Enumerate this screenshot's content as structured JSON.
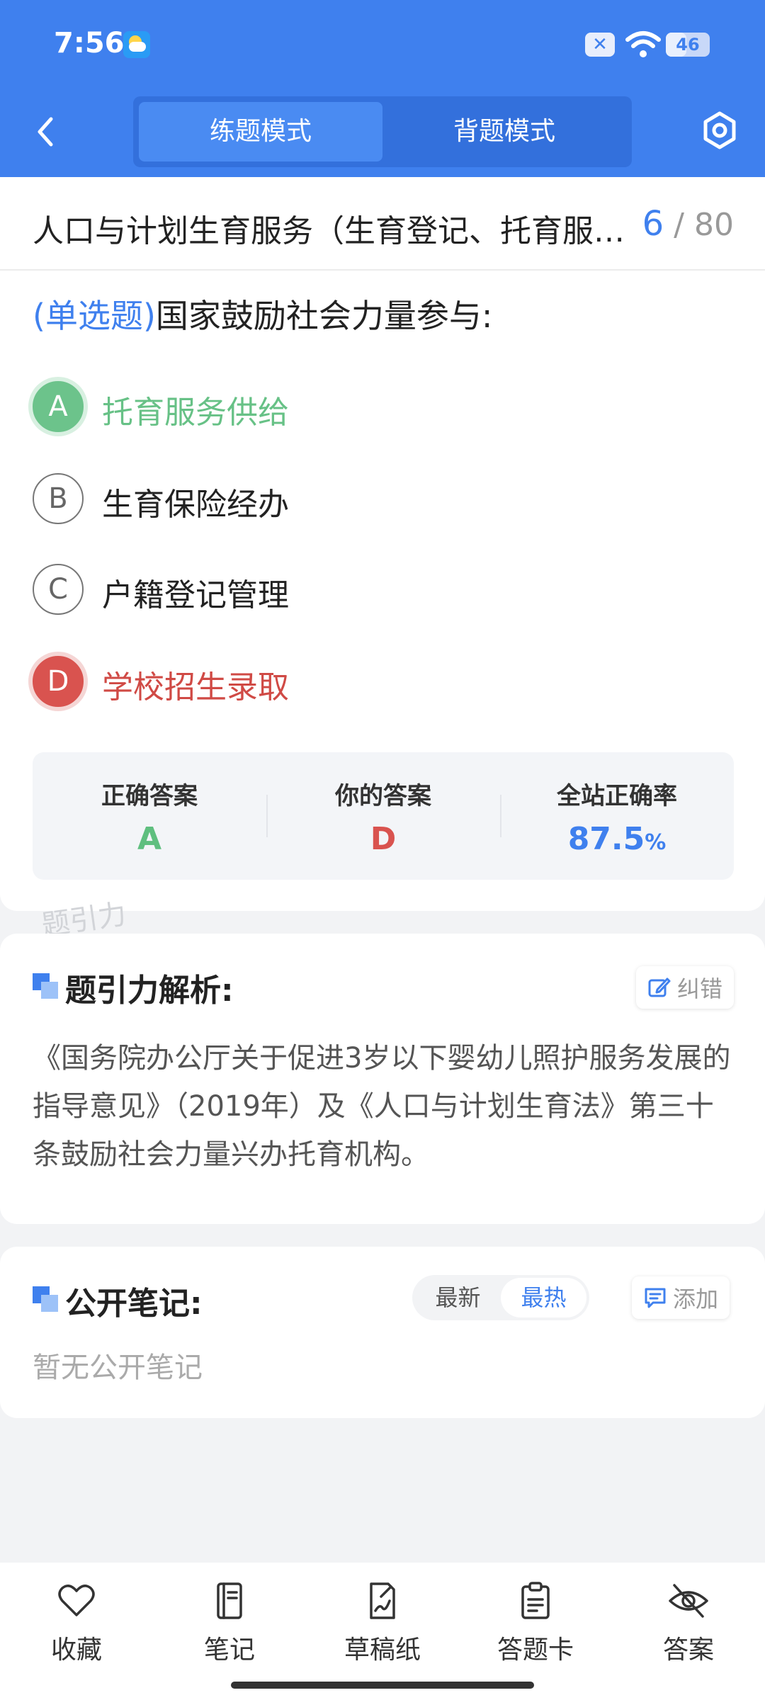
{
  "status_bar": {
    "time": "7:56",
    "battery": "46",
    "battery_level": 0.46
  },
  "header": {
    "tabs": [
      {
        "label": "练题模式",
        "active": true
      },
      {
        "label": "背题模式",
        "active": false
      }
    ]
  },
  "question": {
    "chapter_title": "人口与计划生育服务（生育登记、托育服务、基层卫生）",
    "current": "6",
    "separator": "/",
    "total": "80",
    "type": "(单选题)",
    "text": "国家鼓励社会力量参与:",
    "options": [
      {
        "letter": "A",
        "text": "托育服务供给",
        "state": "correct"
      },
      {
        "letter": "B",
        "text": "生育保险经办",
        "state": "normal"
      },
      {
        "letter": "C",
        "text": "户籍登记管理",
        "state": "normal"
      },
      {
        "letter": "D",
        "text": "学校招生录取",
        "state": "wrong"
      }
    ]
  },
  "answer_summary": {
    "correct_label": "正确答案",
    "correct_value": "A",
    "yours_label": "你的答案",
    "yours_value": "D",
    "rate_label": "全站正确率",
    "rate_value": "87.5",
    "rate_unit": "%"
  },
  "watermark": "题引力",
  "analysis": {
    "title": "题引力解析:",
    "report_label": "纠错",
    "text": "《国务院办公厅关于促进3岁以下婴幼儿照护服务发展的指导意见》（2019年）及《人口与计划生育法》第三十条鼓励社会力量兴办托育机构。"
  },
  "notes": {
    "title": "公开笔记:",
    "sort_options": [
      "最新",
      "最热"
    ],
    "sort_active": "最热",
    "add_label": "添加",
    "empty_text": "暂无公开笔记"
  },
  "bottom_bar": [
    {
      "label": "收藏",
      "icon": "heart-icon"
    },
    {
      "label": "笔记",
      "icon": "notebook-icon"
    },
    {
      "label": "草稿纸",
      "icon": "draft-icon"
    },
    {
      "label": "答题卡",
      "icon": "answer-card-icon"
    },
    {
      "label": "答案",
      "icon": "eye-off-icon"
    }
  ],
  "colors": {
    "primary": "#3f80ee",
    "correct": "#67c186",
    "wrong": "#d04a45"
  }
}
